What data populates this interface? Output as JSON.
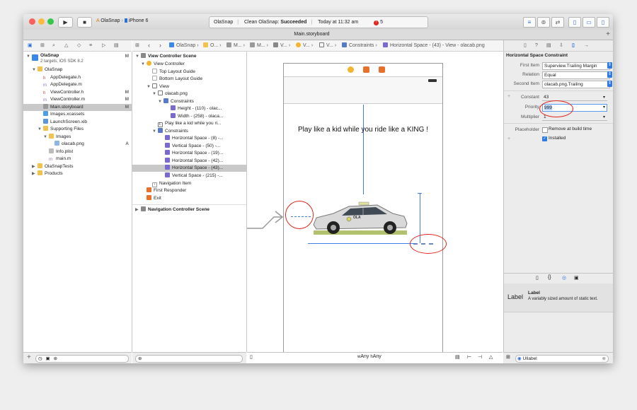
{
  "toolbar": {
    "scheme_app": "OlaSnap",
    "scheme_device": "iPhone 6",
    "status_app": "OlaSnap",
    "status_prefix": "Clean OlaSnap:",
    "status_result": "Succeeded",
    "status_time": "Today at 11:32 am",
    "error_count": "5"
  },
  "tab_title": "Main.storyboard",
  "jumpbar": {
    "items": [
      "OlaSnap",
      "O...",
      "M...",
      "M...",
      "V...",
      "V...",
      "V...",
      "Constraints",
      "Horizontal Space - (43) - View - olacab.png"
    ]
  },
  "navigator": {
    "project": "OlaSnap",
    "project_sub": "2 targets, iOS SDK 8.2",
    "project_badge": "M",
    "group": "OlaSnap",
    "files": [
      {
        "label": "AppDelegate.h",
        "badge": ""
      },
      {
        "label": "AppDelegate.m",
        "badge": ""
      },
      {
        "label": "ViewController.h",
        "badge": "M"
      },
      {
        "label": "ViewController.m",
        "badge": "M"
      },
      {
        "label": "Main.storyboard",
        "badge": "M"
      },
      {
        "label": "Images.xcassets",
        "badge": ""
      },
      {
        "label": "LaunchScreen.xib",
        "badge": ""
      }
    ],
    "supporting": "Supporting Files",
    "images": "Images",
    "olacab": "olacab.png",
    "olacab_badge": "A",
    "infoplist": "Info.plist",
    "mainm": "main.m",
    "tests": "OlaSnapTests",
    "products": "Products"
  },
  "outline": {
    "scene": "View Controller Scene",
    "vc": "View Controller",
    "top_guide": "Top Layout Guide",
    "bottom_guide": "Bottom Layout Guide",
    "view": "View",
    "img": "olacab.png",
    "constraints": "Constraints",
    "height": "Height - (110) - olac...",
    "width": "Width - (258) - olaca...",
    "label": "Play like a kid while you ri...",
    "constraints2": "Constraints",
    "c1": "Horizontal Space - (8) -...",
    "c2": "Vertical Space - (50) -...",
    "c3": "Horizontal Space - (19)...",
    "c4": "Horizontal Space - (42)...",
    "c5": "Horizontal Space - (43)...",
    "c6": "Vertical Space - (215) -...",
    "navitem": "Navigation Item",
    "responder": "First Responder",
    "exit": "Exit",
    "nav_scene": "Navigation Controller Scene"
  },
  "canvas": {
    "headline": "Play like a kid while you ride like a KING !",
    "car_logo": "OLA",
    "size_class": "wAny hAny",
    "size_w": "w",
    "size_w_val": "Any",
    "size_h": "h",
    "size_h_val": "Any"
  },
  "inspector": {
    "title": "Horizontal Space Constraint",
    "first_item_label": "First Item",
    "first_item": "Superview.Trailing Margin",
    "relation_label": "Relation",
    "relation": "Equal",
    "second_item_label": "Second Item",
    "second_item": "olacab.png.Trailing",
    "constant_label": "Constant",
    "constant": "43",
    "priority_label": "Priority",
    "priority": "999",
    "multiplier_label": "Multiplier",
    "multiplier": "1",
    "placeholder_label": "Placeholder",
    "placeholder_check": "Remove at build time",
    "installed": "Installed",
    "lib_title": "Label",
    "lib_desc": "A variably sized amount of static text.",
    "lib_icon": "Label",
    "search_value": "UIlabel"
  },
  "colors": {
    "accent": "#2f7be6",
    "selection": "#c9c9c9",
    "annotation_ring": "#e0261e",
    "error": "#e0261e"
  }
}
